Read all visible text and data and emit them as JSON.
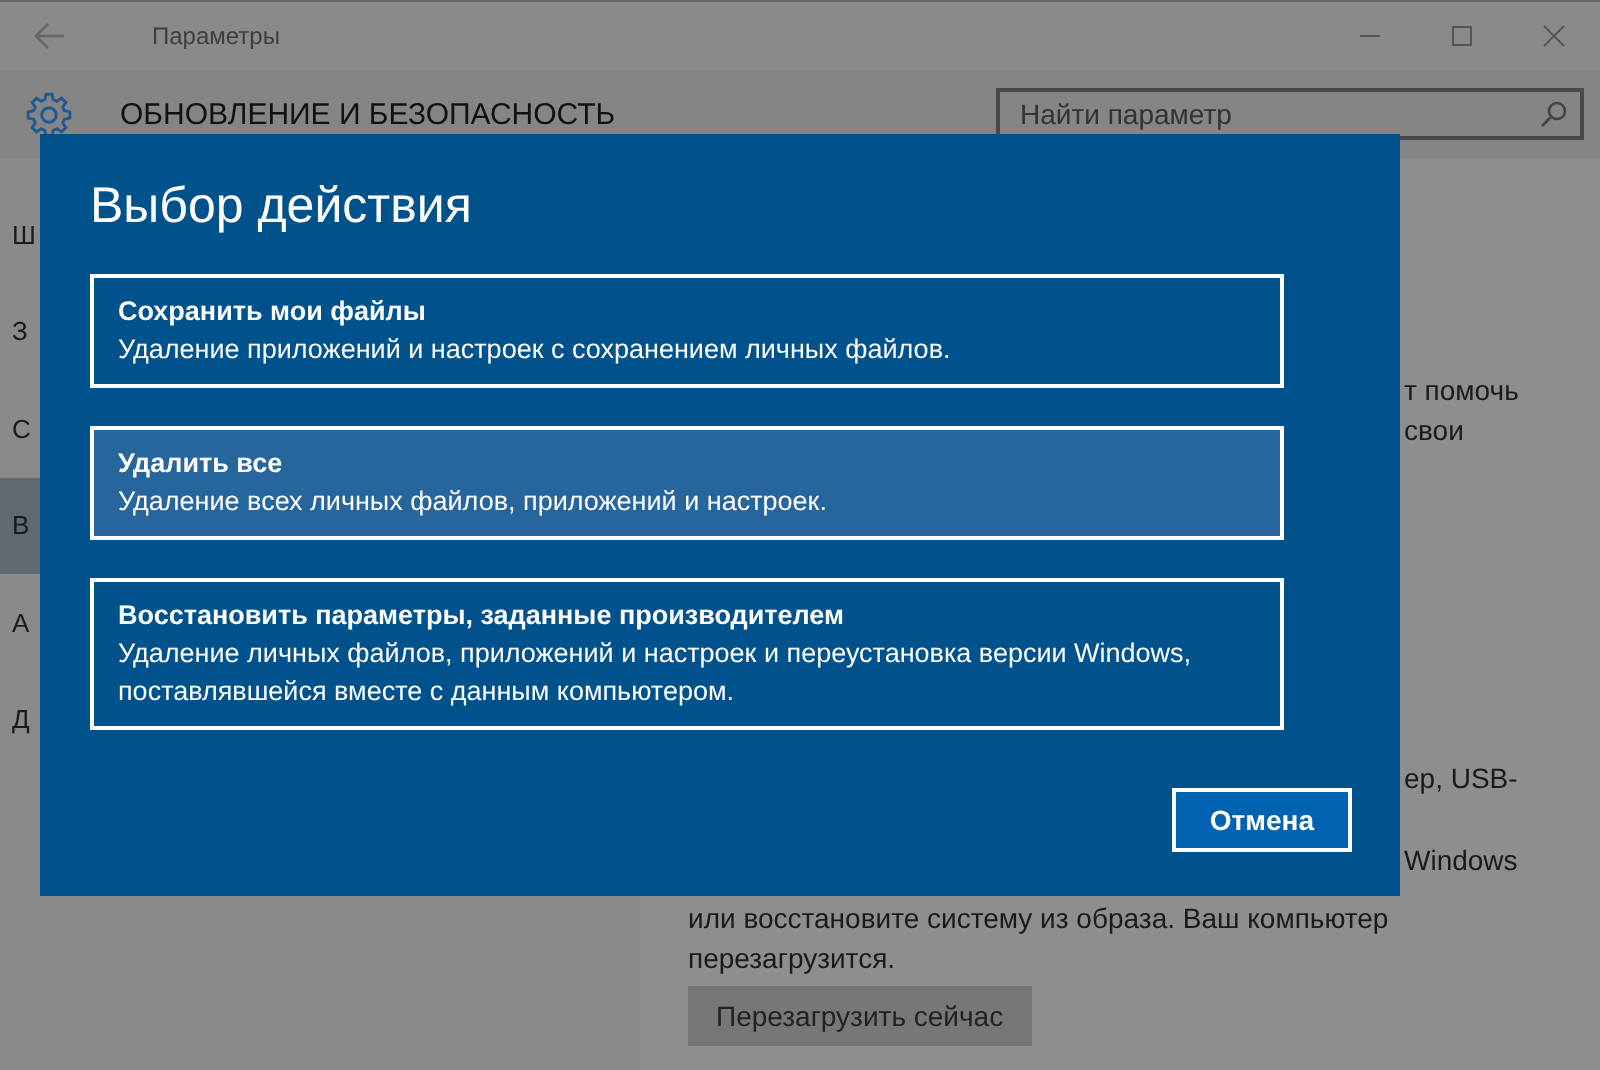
{
  "window": {
    "title": "Параметры"
  },
  "header": {
    "title": "ОБНОВЛЕНИЕ И БЕЗОПАСНОСТЬ",
    "search": {
      "placeholder": "Найти параметр"
    }
  },
  "sidebar": {
    "items": [
      {
        "label": "Ш",
        "selected": false
      },
      {
        "label": "З",
        "selected": false
      },
      {
        "label": "С",
        "selected": false
      },
      {
        "label": "В",
        "selected": true
      },
      {
        "label": "А",
        "selected": false
      },
      {
        "label": "Д",
        "selected": false
      }
    ]
  },
  "content": {
    "top_lines": [
      "т помочь",
      "свои"
    ],
    "bottom_lines": [
      "ер, USB-",
      "Windows"
    ],
    "lines": [
      "или восстановите систему из образа. Ваш компьютер",
      "перезагрузится."
    ],
    "restart_button": "Перезагрузить сейчас"
  },
  "dialog": {
    "title": "Выбор действия",
    "options": [
      {
        "title": "Сохранить мои файлы",
        "description": "Удаление приложений и настроек с сохранением личных файлов.",
        "selected": false
      },
      {
        "title": "Удалить все",
        "description": "Удаление всех личных файлов, приложений и настроек.",
        "selected": true
      },
      {
        "title": "Восстановить параметры, заданные производителем",
        "description": "Удаление личных файлов, приложений и настроек и переустановка версии Windows, поставлявшейся вместе с данным компьютером.",
        "selected": false
      }
    ],
    "cancel_button": "Отмена"
  }
}
